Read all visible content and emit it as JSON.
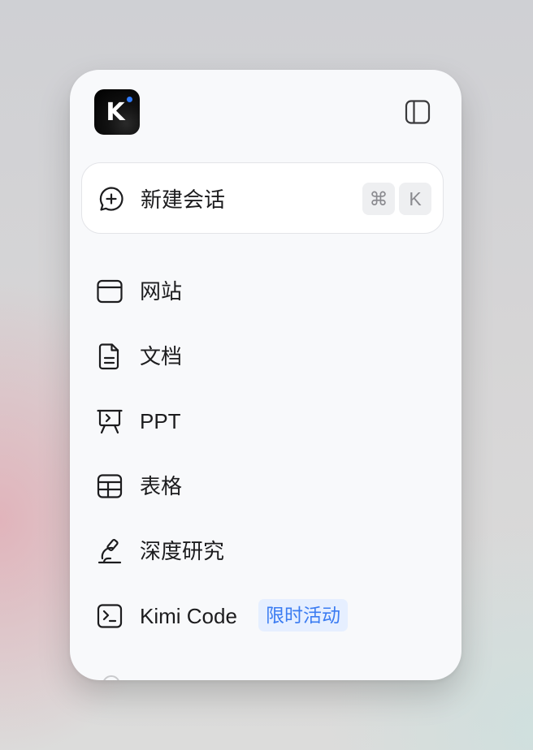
{
  "app": {
    "logo_letter": "K",
    "accent_dot_color": "#2f7bff"
  },
  "header": {
    "sidebar_toggle_icon": "sidebar-toggle-icon"
  },
  "new_chat": {
    "label": "新建会话",
    "icon": "chat-plus-icon",
    "shortcut_modifier": "⌘",
    "shortcut_key": "K"
  },
  "menu": {
    "items": [
      {
        "label": "网站",
        "icon": "browser-window-icon"
      },
      {
        "label": "文档",
        "icon": "document-icon"
      },
      {
        "label": "PPT",
        "icon": "presentation-icon"
      },
      {
        "label": "表格",
        "icon": "table-icon"
      },
      {
        "label": "深度研究",
        "icon": "microscope-icon"
      },
      {
        "label": "Kimi Code",
        "icon": "terminal-icon",
        "badge": "限时活动"
      }
    ]
  },
  "colors": {
    "panel_bg": "#f8f9fb",
    "text": "#1c1c1e",
    "badge_bg": "#e6efff",
    "badge_text": "#3b7cf2"
  }
}
